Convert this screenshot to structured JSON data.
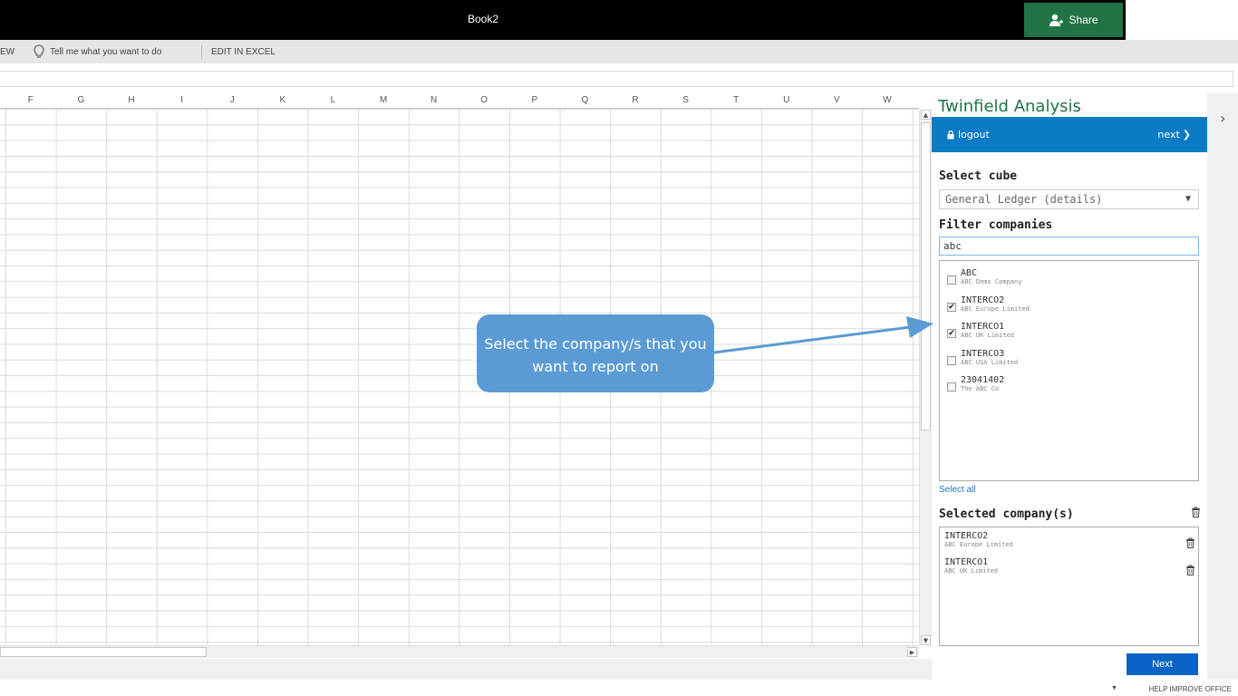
{
  "window": {
    "title": "Book2",
    "share_label": "Share"
  },
  "ribbon": {
    "partial_tab": "EW",
    "tell_me": "Tell me what you want to do",
    "edit_in_excel": "EDIT IN EXCEL"
  },
  "grid": {
    "columns": [
      "F",
      "G",
      "H",
      "I",
      "J",
      "K",
      "L",
      "M",
      "N",
      "O",
      "P",
      "Q",
      "R",
      "S",
      "T",
      "U",
      "V",
      "W"
    ]
  },
  "pane": {
    "title": "Twinfield Analysis",
    "logout_label": "logout",
    "next_link_label": "next",
    "select_cube_label": "Select cube",
    "cube_value": "General Ledger (details)",
    "filter_label": "Filter companies",
    "filter_value": "abc",
    "companies": [
      {
        "code": "ABC",
        "name": "ABC Demo Company",
        "checked": false
      },
      {
        "code": "INTERCO2",
        "name": "ABC Europe Limited",
        "checked": true
      },
      {
        "code": "INTERCO1",
        "name": "ABC UK Limited",
        "checked": true
      },
      {
        "code": "INTERCO3",
        "name": "ABC USA Limited",
        "checked": false
      },
      {
        "code": "23041402",
        "name": "The ABC Co",
        "checked": false
      }
    ],
    "select_all_label": "Select all",
    "selected_label": "Selected company(s)",
    "selected": [
      {
        "code": "INTERCO2",
        "name": "ABC Europe Limited"
      },
      {
        "code": "INTERCO1",
        "name": "ABC UK Limited"
      }
    ],
    "next_button_label": "Next"
  },
  "callout": {
    "text": "Select the company/s that you want to report on"
  },
  "statusbar": {
    "help": "HELP IMPROVE OFFICE"
  },
  "colors": {
    "excel_green": "#217346",
    "pane_blue": "#0c7bc5",
    "button_blue": "#0c63c6",
    "callout_blue": "#5b9bd5"
  }
}
